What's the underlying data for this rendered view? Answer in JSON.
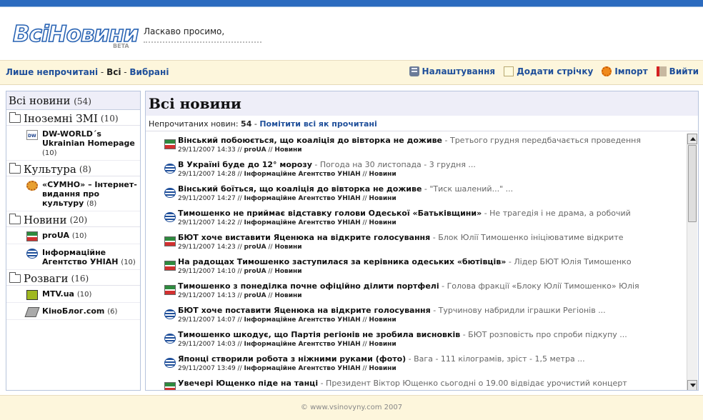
{
  "header": {
    "logo_text": "ВсіНовини",
    "logo_badge": "BETA",
    "welcome": "Ласкаво просимо,"
  },
  "nav": {
    "filters": {
      "unread": "Лише непрочитані",
      "sep1": " - ",
      "all": "Всі",
      "sep2": " - ",
      "starred": "Вибрані"
    },
    "actions": [
      {
        "label": "Налаштування",
        "icon": "settings-icon"
      },
      {
        "label": "Додати стрічку",
        "icon": "add-feed-icon"
      },
      {
        "label": "Імпорт",
        "icon": "import-icon"
      },
      {
        "label": "Вийти",
        "icon": "exit-icon"
      }
    ]
  },
  "sidebar": {
    "all": {
      "label": "Всі новини",
      "count": "(54)"
    },
    "categories": [
      {
        "name": "Іноземні ЗМІ",
        "count": "(10)",
        "feeds": [
          {
            "name": "DW-WORLD´s Ukrainian Homepage",
            "count": "(10)",
            "icon": "dw-icon"
          }
        ]
      },
      {
        "name": "Культура",
        "count": "(8)",
        "feeds": [
          {
            "name": "«СУМНО» – Інтернет-видання про культуру",
            "count": "(8)",
            "icon": "sumno-icon"
          }
        ]
      },
      {
        "name": "Новини",
        "count": "(20)",
        "feeds": [
          {
            "name": "proUA",
            "count": "(10)",
            "icon": "proua-icon"
          },
          {
            "name": "Інформаційне Агентство УНІАН",
            "count": "(10)",
            "icon": "unian-icon"
          }
        ]
      },
      {
        "name": "Розваги",
        "count": "(16)",
        "feeds": [
          {
            "name": "MTV.ua",
            "count": "(10)",
            "icon": "mtv-icon"
          },
          {
            "name": "КіноБлог.com",
            "count": "(6)",
            "icon": "kinoblog-icon"
          }
        ]
      }
    ]
  },
  "main": {
    "title": "Всі новини",
    "unread_label": "Непрочитаних новин:",
    "unread_count": "54",
    "unread_sep": " - ",
    "mark_all": "Помітити всі як прочитані",
    "items": [
      {
        "title": "Вінський побоюється, що коаліція до вівторка не доживе",
        "snippet": " - Третього грудня передбачається проведення",
        "date": "29/11/2007 14:33",
        "source": "proUA",
        "category": "Новини",
        "icon": "proua-icon"
      },
      {
        "title": "В Україні буде до 12° морозу",
        "snippet": " - Погода на 30 листопада - 3 грудня ...",
        "date": "29/11/2007 14:28",
        "source": "Інформаційне Агентство УНІАН",
        "category": "Новини",
        "icon": "unian-icon"
      },
      {
        "title": "Вінський боїться, що коаліція до вівторка не доживе",
        "snippet": " - \"Тиск шалений...\" ...",
        "date": "29/11/2007 14:27",
        "source": "Інформаційне Агентство УНІАН",
        "category": "Новини",
        "icon": "unian-icon"
      },
      {
        "title": "Тимошенко не приймає відставку голови Одеської «Батьківщини»",
        "snippet": " - Не трагедія і не драма, а робочий",
        "date": "29/11/2007 14:22",
        "source": "Інформаційне Агентство УНІАН",
        "category": "Новини",
        "icon": "unian-icon"
      },
      {
        "title": "БЮТ хоче виставити Яценюка на відкрите голосування",
        "snippet": " - Блок Юлії Тимошенко ініціюватиме відкрите",
        "date": "29/11/2007 14:23",
        "source": "proUA",
        "category": "Новини",
        "icon": "proua-icon"
      },
      {
        "title": "На радощах Тимошенко заступилася за керівника одеських «бютівців»",
        "snippet": " - Лідер БЮТ Юлія Тимошенко",
        "date": "29/11/2007 14:10",
        "source": "proUA",
        "category": "Новини",
        "icon": "proua-icon"
      },
      {
        "title": "Тимошенко з понеділка почне офіційно ділити портфелі",
        "snippet": " - Голова фракції «Блоку Юлії Тимошенко» Юлія",
        "date": "29/11/2007 14:13",
        "source": "proUA",
        "category": "Новини",
        "icon": "proua-icon"
      },
      {
        "title": "БЮТ хоче поставити Яценюка на відкрите голосування",
        "snippet": " - Турчинову набридли іграшки Регіонів ...",
        "date": "29/11/2007 14:07",
        "source": "Інформаційне Агентство УНІАН",
        "category": "Новини",
        "icon": "unian-icon"
      },
      {
        "title": "Тимошенко шкодує, що Партія регіонів не зробила висновків",
        "snippet": " - БЮТ розповість про спроби підкупу ...",
        "date": "29/11/2007 14:03",
        "source": "Інформаційне Агентство УНІАН",
        "category": "Новини",
        "icon": "unian-icon"
      },
      {
        "title": "Японці створили робота з ніжними руками (фото)",
        "snippet": " - Вага - 111 кілограмів, зріст - 1,5 метра ...",
        "date": "29/11/2007 13:49",
        "source": "Інформаційне Агентство УНІАН",
        "category": "Новини",
        "icon": "unian-icon"
      },
      {
        "title": "Увечері Ющенко піде на танці",
        "snippet": " - Президент Віктор Ющенко сьогодні о 19.00 відвідає урочистий концерт",
        "date": "",
        "source": "",
        "category": "",
        "icon": "proua-icon"
      }
    ]
  },
  "footer": {
    "text": "© www.vsinovyny.com 2007"
  }
}
